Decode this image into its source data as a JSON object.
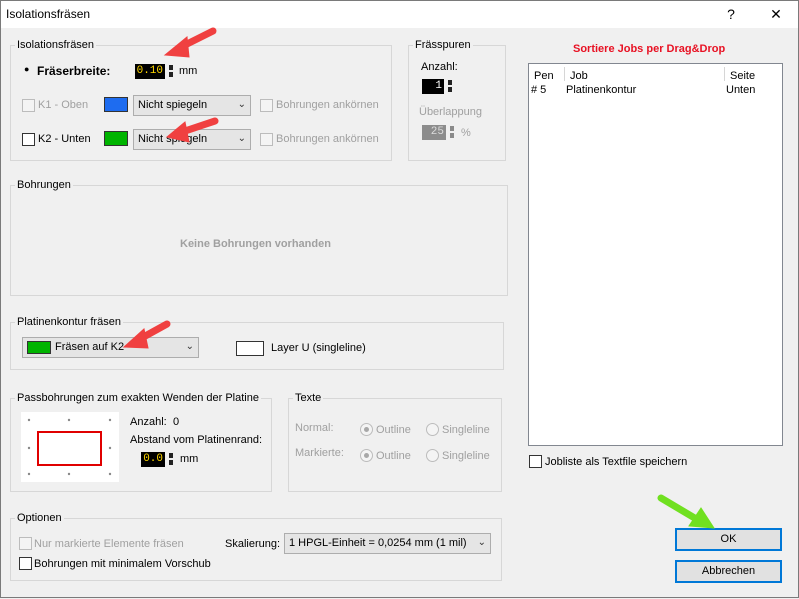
{
  "window": {
    "title": "Isolationsfräsen",
    "help": "?",
    "close": "✕"
  },
  "isolation": {
    "label": "Isolationsfräsen",
    "width_label": "Fräserbreite:",
    "width_value": "0.10",
    "width_unit": "mm",
    "k1": {
      "label": "K1 - Oben",
      "color": "#1e6cf0",
      "mirror": "Nicht spiegeln",
      "drill": "Bohrungen ankörnen"
    },
    "k2": {
      "label": "K2 - Unten",
      "color": "#00b400",
      "mirror": "Nicht spiegeln",
      "drill": "Bohrungen ankörnen"
    }
  },
  "passes": {
    "label": "Frässpuren",
    "count_label": "Anzahl:",
    "count_value": "1",
    "overlap_label": "Überlappung",
    "overlap_value": "25",
    "overlap_unit": "%"
  },
  "bohrungen": {
    "label": "Bohrungen",
    "empty": "Keine Bohrungen vorhanden"
  },
  "contour": {
    "label": "Platinenkontur fräsen",
    "select": "Fräsen auf K2",
    "select_color": "#00b400",
    "layer_label": "Layer U (singleline)",
    "layer_color": "#ffffff"
  },
  "passbohr": {
    "label": "Passbohrungen zum exakten Wenden der Platine",
    "count_label": "Anzahl:",
    "count_value": "0",
    "distance_label": "Abstand vom Platinenrand:",
    "distance_value": "0.0",
    "distance_unit": "mm"
  },
  "texte": {
    "label": "Texte",
    "normal_label": "Normal:",
    "marked_label": "Markierte:",
    "outline": "Outline",
    "singleline": "Singleline"
  },
  "options": {
    "label": "Optionen",
    "only_marked": "Nur markierte Elemente fräsen",
    "min_feed": "Bohrungen mit minimalem Vorschub",
    "scale_label": "Skalierung:",
    "scale_value": "1 HPGL-Einheit = 0,0254 mm (1 mil)"
  },
  "jobs": {
    "title": "Sortiere Jobs per Drag&Drop",
    "columns": {
      "pen": "Pen",
      "job": "Job",
      "side": "Seite"
    },
    "rows": [
      {
        "pen": "# 5",
        "job": "Platinenkontur",
        "side": "Unten"
      }
    ],
    "save_label": "Jobliste als Textfile speichern"
  },
  "buttons": {
    "ok": "OK",
    "cancel": "Abbrechen"
  },
  "annotation_colors": {
    "red": "#f04040",
    "green": "#70e020"
  }
}
